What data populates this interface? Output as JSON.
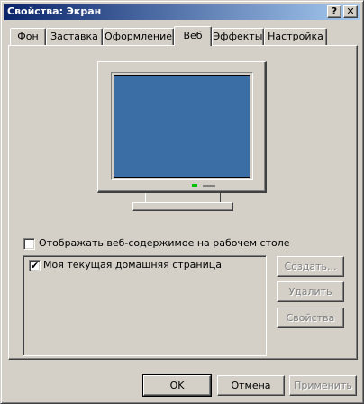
{
  "window": {
    "title": "Свойства: Экран",
    "help_label": "?",
    "close_label": "✕"
  },
  "tabs": [
    {
      "label": "Фон",
      "active": false
    },
    {
      "label": "Заставка",
      "active": false
    },
    {
      "label": "Оформление",
      "active": false
    },
    {
      "label": "Веб",
      "active": true
    },
    {
      "label": "Эффекты",
      "active": false
    },
    {
      "label": "Настройка",
      "active": false
    }
  ],
  "web_tab": {
    "show_web_content": {
      "label": "Отображать веб-содержимое на рабочем столе",
      "checked": false
    },
    "items": [
      {
        "label": "Моя текущая домашняя страница",
        "checked": true
      }
    ],
    "check_mark": "✔",
    "buttons": {
      "create": "Создать...",
      "delete": "Удалить",
      "properties": "Свойства"
    }
  },
  "dialog_buttons": {
    "ok": "OK",
    "cancel": "Отмена",
    "apply": "Применить"
  },
  "colors": {
    "title_gradient_start": "#0a246a",
    "title_gradient_end": "#a6caf0",
    "desktop_preview": "#3a6ea5",
    "face": "#d4d0c8"
  },
  "icons": [
    "help-icon",
    "close-icon",
    "monitor-preview"
  ]
}
